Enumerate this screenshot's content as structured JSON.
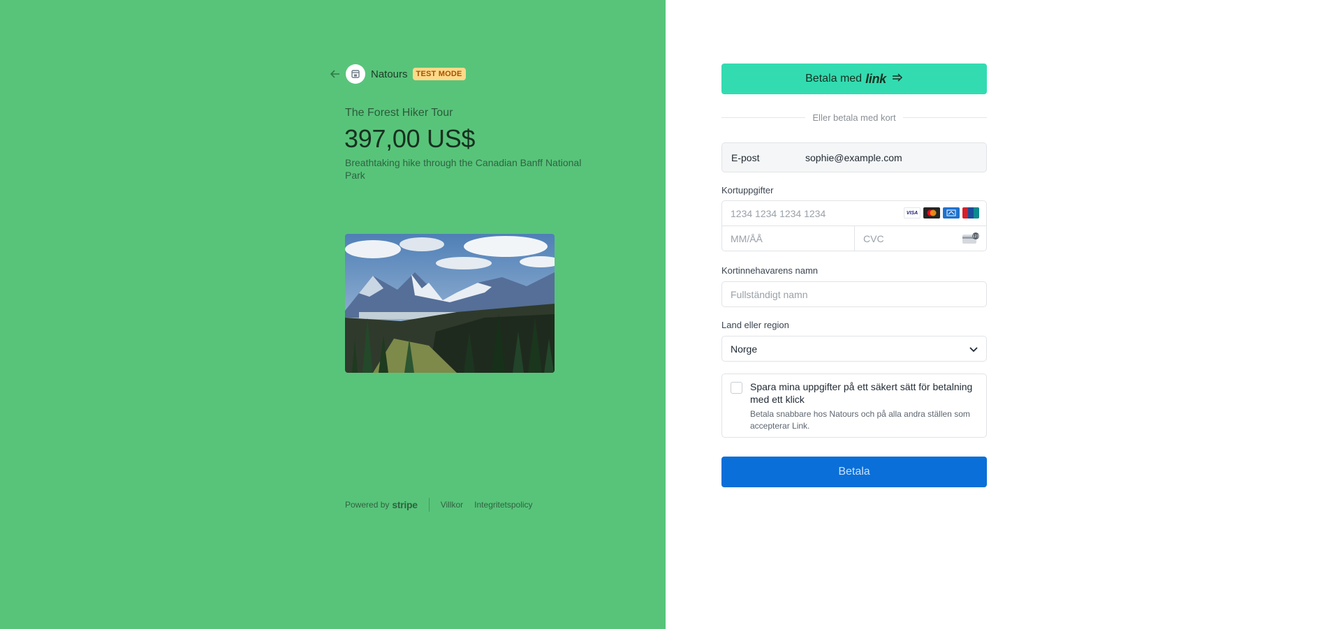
{
  "left": {
    "merchant": "Natours",
    "badge": "TEST MODE",
    "product_name": "The Forest Hiker Tour",
    "price": "397,00 US$",
    "description": "Breathtaking hike through the Canadian Banff National Park",
    "background_color": "#58c47a",
    "footer": {
      "powered_by": "Powered by",
      "stripe": "stripe",
      "terms": "Villkor",
      "privacy": "Integritetspolicy"
    }
  },
  "right": {
    "link_button": {
      "label": "Betala med",
      "brand": "link",
      "icon": "arrow-right-icon"
    },
    "divider_text": "Eller betala med kort",
    "email": {
      "label": "E-post",
      "value": "sophie@example.com"
    },
    "card": {
      "label": "Kortuppgifter",
      "number_placeholder": "1234 1234 1234 1234",
      "expiry_placeholder": "MM/ÅÅ",
      "cvc_placeholder": "CVC",
      "brands": [
        "visa",
        "mastercard",
        "amex",
        "unionpay"
      ],
      "visa_text": "VISA"
    },
    "name": {
      "label": "Kortinnehavarens namn",
      "placeholder": "Fullständigt namn"
    },
    "country": {
      "label": "Land eller region",
      "value": "Norge"
    },
    "save": {
      "title": "Spara mina uppgifter på ett säkert sätt för betalning med ett klick",
      "subtitle": "Betala snabbare hos Natours och på alla andra ställen som accepterar Link.",
      "checked": false
    },
    "pay_button": "Betala",
    "colors": {
      "link": "#33dbb1",
      "pay": "#0a6fd8"
    }
  }
}
